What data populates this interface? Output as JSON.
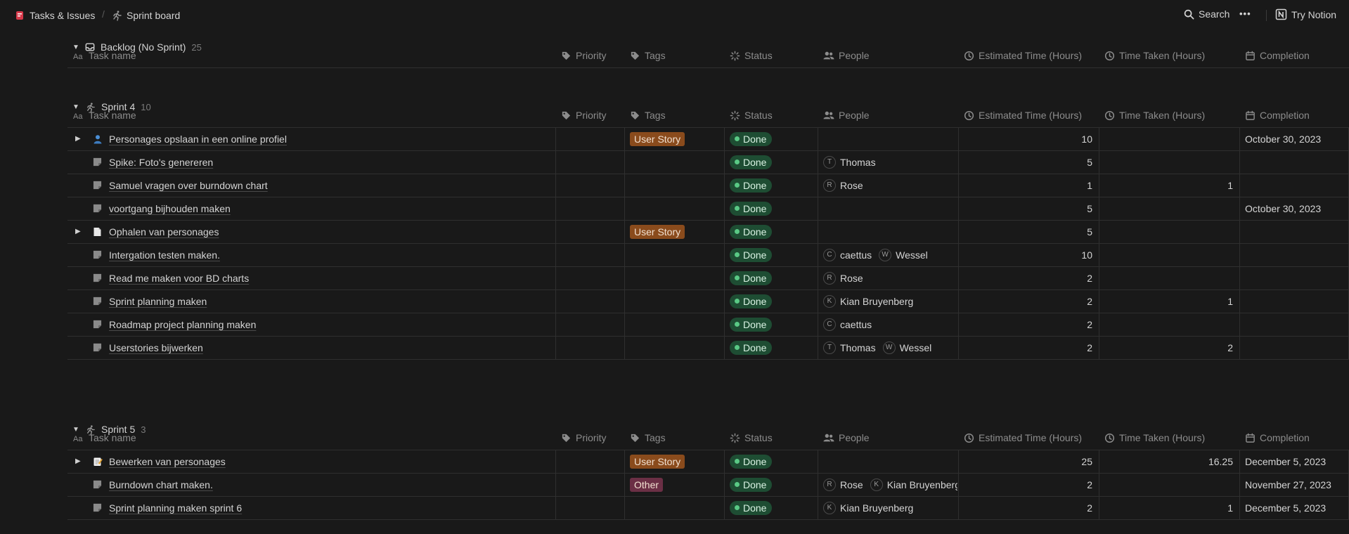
{
  "breadcrumb": {
    "workspace": "Tasks & Issues",
    "separator": "/",
    "page": "Sprint board"
  },
  "topbar": {
    "search": "Search",
    "more": "•••",
    "try": "Try Notion"
  },
  "columns": {
    "task": "Task name",
    "priority": "Priority",
    "tags": "Tags",
    "status": "Status",
    "people": "People",
    "estimated": "Estimated Time (Hours)",
    "taken": "Time Taken (Hours)",
    "completion": "Completion"
  },
  "colors": {
    "user_story_tag": "#8a4b1c",
    "other_tag": "#6b2f45",
    "status_done_bg": "#1e4d33",
    "status_done_dot": "#5ac985"
  },
  "groups": [
    {
      "name": "Backlog (No Sprint)",
      "count": "25",
      "icon": "inbox-icon",
      "rows": []
    },
    {
      "name": "Sprint 4",
      "count": "10",
      "icon": "runner-icon",
      "rows": [
        {
          "name": "Personages opslaan in een online profiel",
          "icon": "person-icon",
          "expandable": true,
          "tag": "User Story",
          "status": "Done",
          "people": [],
          "est": "10",
          "taken": "",
          "completion": "October 30, 2023"
        },
        {
          "name": "Spike: Foto's genereren",
          "icon": "task-icon",
          "expandable": false,
          "tag": "",
          "status": "Done",
          "people": [
            {
              "initial": "T",
              "name": "Thomas"
            }
          ],
          "est": "5",
          "taken": "",
          "completion": ""
        },
        {
          "name": "Samuel vragen over burndown chart",
          "icon": "task-icon",
          "expandable": false,
          "tag": "",
          "status": "Done",
          "people": [
            {
              "initial": "R",
              "name": "Rose"
            }
          ],
          "est": "1",
          "taken": "1",
          "completion": ""
        },
        {
          "name": "voortgang bijhouden maken",
          "icon": "task-icon",
          "expandable": false,
          "tag": "",
          "status": "Done",
          "people": [],
          "est": "5",
          "taken": "",
          "completion": "October 30, 2023"
        },
        {
          "name": "Ophalen van personages",
          "icon": "page-icon",
          "expandable": true,
          "tag": "User Story",
          "status": "Done",
          "people": [],
          "est": "5",
          "taken": "",
          "completion": ""
        },
        {
          "name": "Intergation testen maken.",
          "icon": "task-icon",
          "expandable": false,
          "tag": "",
          "status": "Done",
          "people": [
            {
              "initial": "C",
              "name": "caettus"
            },
            {
              "initial": "W",
              "name": "Wessel"
            }
          ],
          "est": "10",
          "taken": "",
          "completion": ""
        },
        {
          "name": "Read me maken voor BD charts",
          "icon": "task-icon",
          "expandable": false,
          "tag": "",
          "status": "Done",
          "people": [
            {
              "initial": "R",
              "name": "Rose"
            }
          ],
          "est": "2",
          "taken": "",
          "completion": ""
        },
        {
          "name": "Sprint planning maken",
          "icon": "task-icon",
          "expandable": false,
          "tag": "",
          "status": "Done",
          "people": [
            {
              "initial": "K",
              "name": "Kian Bruyenberg"
            }
          ],
          "est": "2",
          "taken": "1",
          "completion": ""
        },
        {
          "name": "Roadmap project planning maken",
          "icon": "task-icon",
          "expandable": false,
          "tag": "",
          "status": "Done",
          "people": [
            {
              "initial": "C",
              "name": "caettus"
            }
          ],
          "est": "2",
          "taken": "",
          "completion": ""
        },
        {
          "name": "Userstories bijwerken",
          "icon": "task-icon",
          "expandable": false,
          "tag": "",
          "status": "Done",
          "people": [
            {
              "initial": "T",
              "name": "Thomas"
            },
            {
              "initial": "W",
              "name": "Wessel"
            }
          ],
          "est": "2",
          "taken": "2",
          "completion": ""
        }
      ]
    },
    {
      "name": "Sprint 5",
      "count": "3",
      "icon": "runner-icon",
      "rows": [
        {
          "name": "Bewerken van personages",
          "icon": "memo-icon",
          "expandable": true,
          "tag": "User Story",
          "status": "Done",
          "people": [],
          "est": "25",
          "taken": "16.25",
          "completion": "December 5, 2023"
        },
        {
          "name": "Burndown chart maken.",
          "icon": "task-icon",
          "expandable": false,
          "tag": "Other",
          "status": "Done",
          "people": [
            {
              "initial": "R",
              "name": "Rose"
            },
            {
              "initial": "K",
              "name": "Kian Bruyenberg"
            }
          ],
          "est": "2",
          "taken": "",
          "completion": "November 27, 2023"
        },
        {
          "name": "Sprint planning maken sprint 6",
          "icon": "task-icon",
          "expandable": false,
          "tag": "",
          "status": "Done",
          "people": [
            {
              "initial": "K",
              "name": "Kian Bruyenberg"
            }
          ],
          "est": "2",
          "taken": "1",
          "completion": "December 5, 2023"
        }
      ]
    }
  ]
}
